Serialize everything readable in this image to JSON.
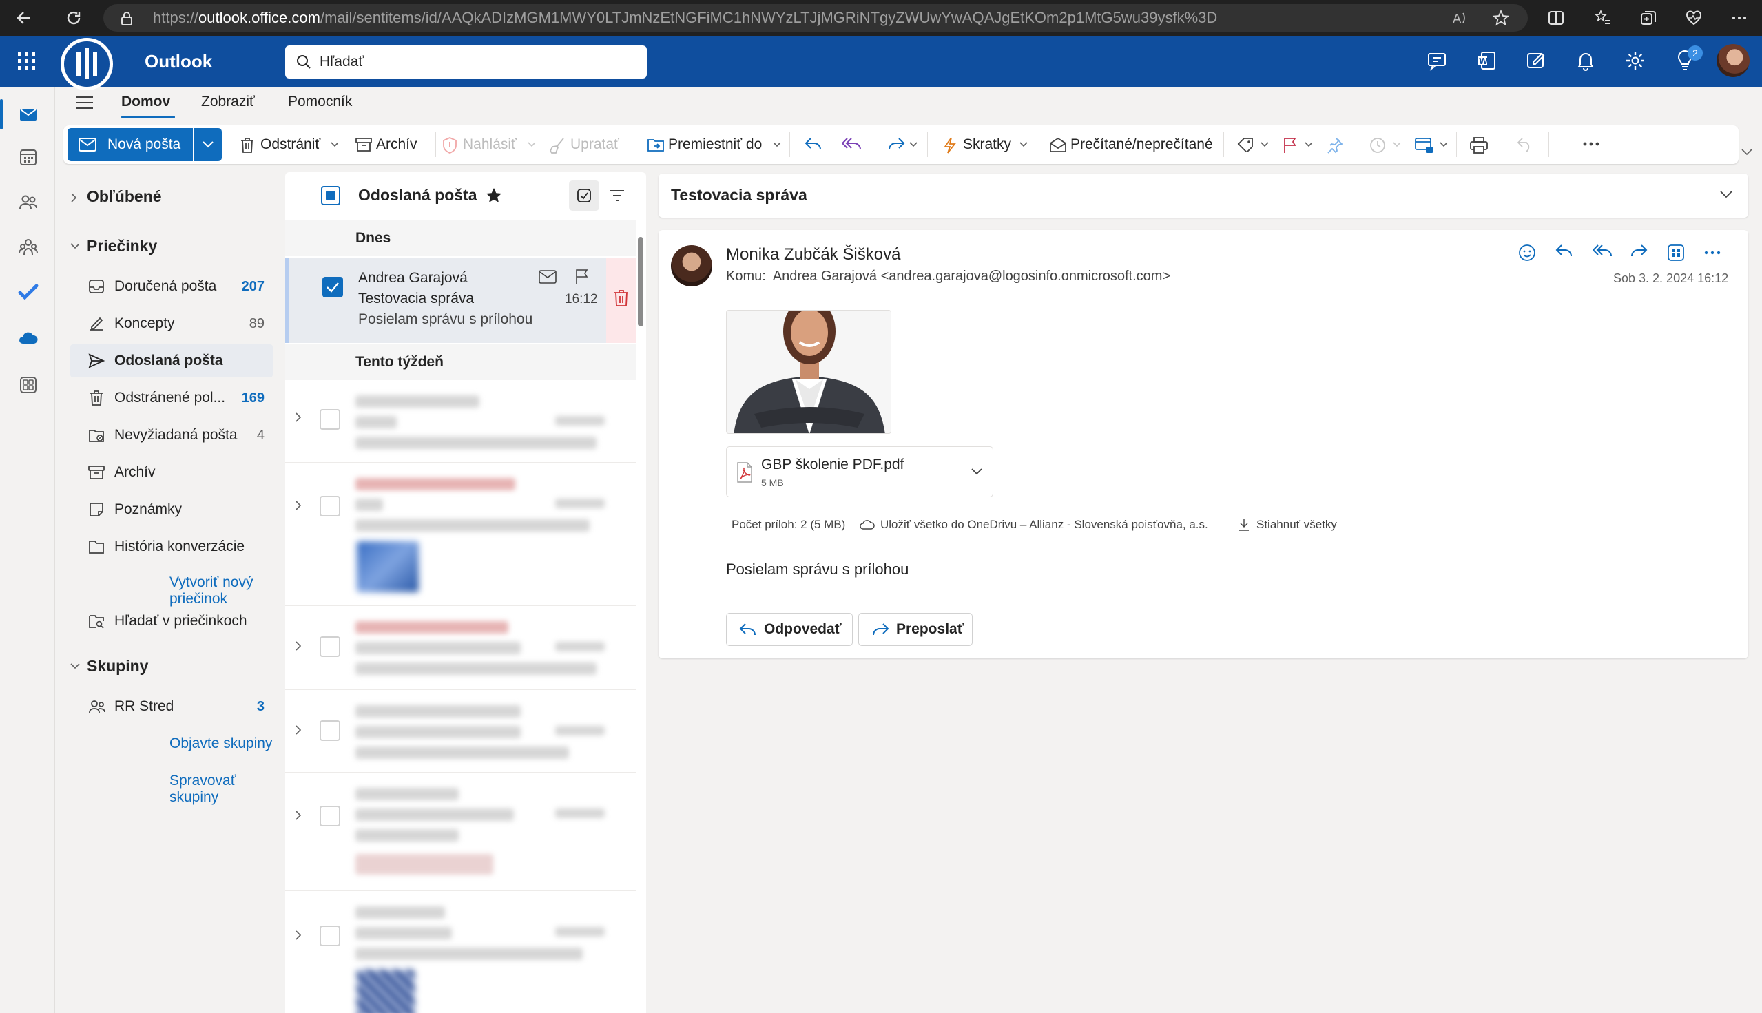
{
  "browser": {
    "url_prefix": "https://",
    "url_host": "outlook.office.com",
    "url_path": "/mail/sentitems/id/AAQkADIzMGM1MWY0LTJmNzEtNGFiMC1hNWYzLTJjMGRiNTgyZWUwYwAQAJgEtKOm2p1MtG5wu39ysfk%3D",
    "profile_badge": "2"
  },
  "header": {
    "app_name": "Outlook",
    "search_placeholder": "Hľadať",
    "brand_color": "#0f4e9e"
  },
  "tabs": [
    {
      "label": "Domov",
      "active": true
    },
    {
      "label": "Zobraziť",
      "active": false
    },
    {
      "label": "Pomocník",
      "active": false
    }
  ],
  "ribbon": {
    "new_mail": "Nová pošta",
    "delete": "Odstrániť",
    "archive": "Archív",
    "report": "Nahlásiť",
    "sweep": "Upratať",
    "move_to": "Premiestniť do",
    "quick_steps": "Skratky",
    "read_unread": "Prečítané/neprečítané"
  },
  "folders": {
    "favorites": "Obľúbené",
    "folders_section": "Priečinky",
    "items": [
      {
        "label": "Doručená pošta",
        "count": "207",
        "count_style": "blue",
        "icon": "inbox-icon"
      },
      {
        "label": "Koncepty",
        "count": "89",
        "count_style": "gray",
        "icon": "draft-icon"
      },
      {
        "label": "Odoslaná pošta",
        "count": "",
        "count_style": "",
        "icon": "send-icon",
        "selected": true
      },
      {
        "label": "Odstránené pol...",
        "count": "169",
        "count_style": "blue",
        "icon": "trash-icon"
      },
      {
        "label": "Nevyžiadaná pošta",
        "count": "4",
        "count_style": "gray",
        "icon": "junk-icon"
      },
      {
        "label": "Archív",
        "count": "",
        "count_style": "",
        "icon": "archive-icon"
      },
      {
        "label": "Poznámky",
        "count": "",
        "count_style": "",
        "icon": "note-icon"
      },
      {
        "label": "História konverzácie",
        "count": "",
        "count_style": "",
        "icon": "folder-icon"
      }
    ],
    "create_folder": "Vytvoriť nový priečinok",
    "search_folders": "Hľadať v priečinkoch",
    "groups_section": "Skupiny",
    "group_item": {
      "label": "RR Stred",
      "count": "3"
    },
    "discover_groups": "Objavte skupiny",
    "manage_groups": "Spravovať skupiny"
  },
  "message_list": {
    "title": "Odoslaná pošta",
    "group_today": "Dnes",
    "group_week": "Tento týždeň",
    "selected_message": {
      "from": "Andrea Garajová",
      "subject": "Testovacia správa",
      "preview": "Posielam správu s prílohou",
      "time": "16:12"
    }
  },
  "reading": {
    "subject": "Testovacia správa",
    "sender": "Monika Zubčák Šišková",
    "to_label": "Komu:",
    "to_value": "Andrea Garajová <andrea.garajova@logosinfo.onmicrosoft.com>",
    "date": "Sob 3. 2. 2024 16:12",
    "attachment": {
      "name": "GBP školenie PDF.pdf",
      "size": "5 MB"
    },
    "attachment_count": "Počet príloh: 2 (5 MB)",
    "save_onedrive": "Uložiť všetko do OneDrivu – Allianz - Slovenská poisťovňa, a.s.",
    "download_all": "Stiahnuť všetky",
    "body": "Posielam správu s prílohou",
    "reply": "Odpovedať",
    "forward": "Preposlať"
  }
}
